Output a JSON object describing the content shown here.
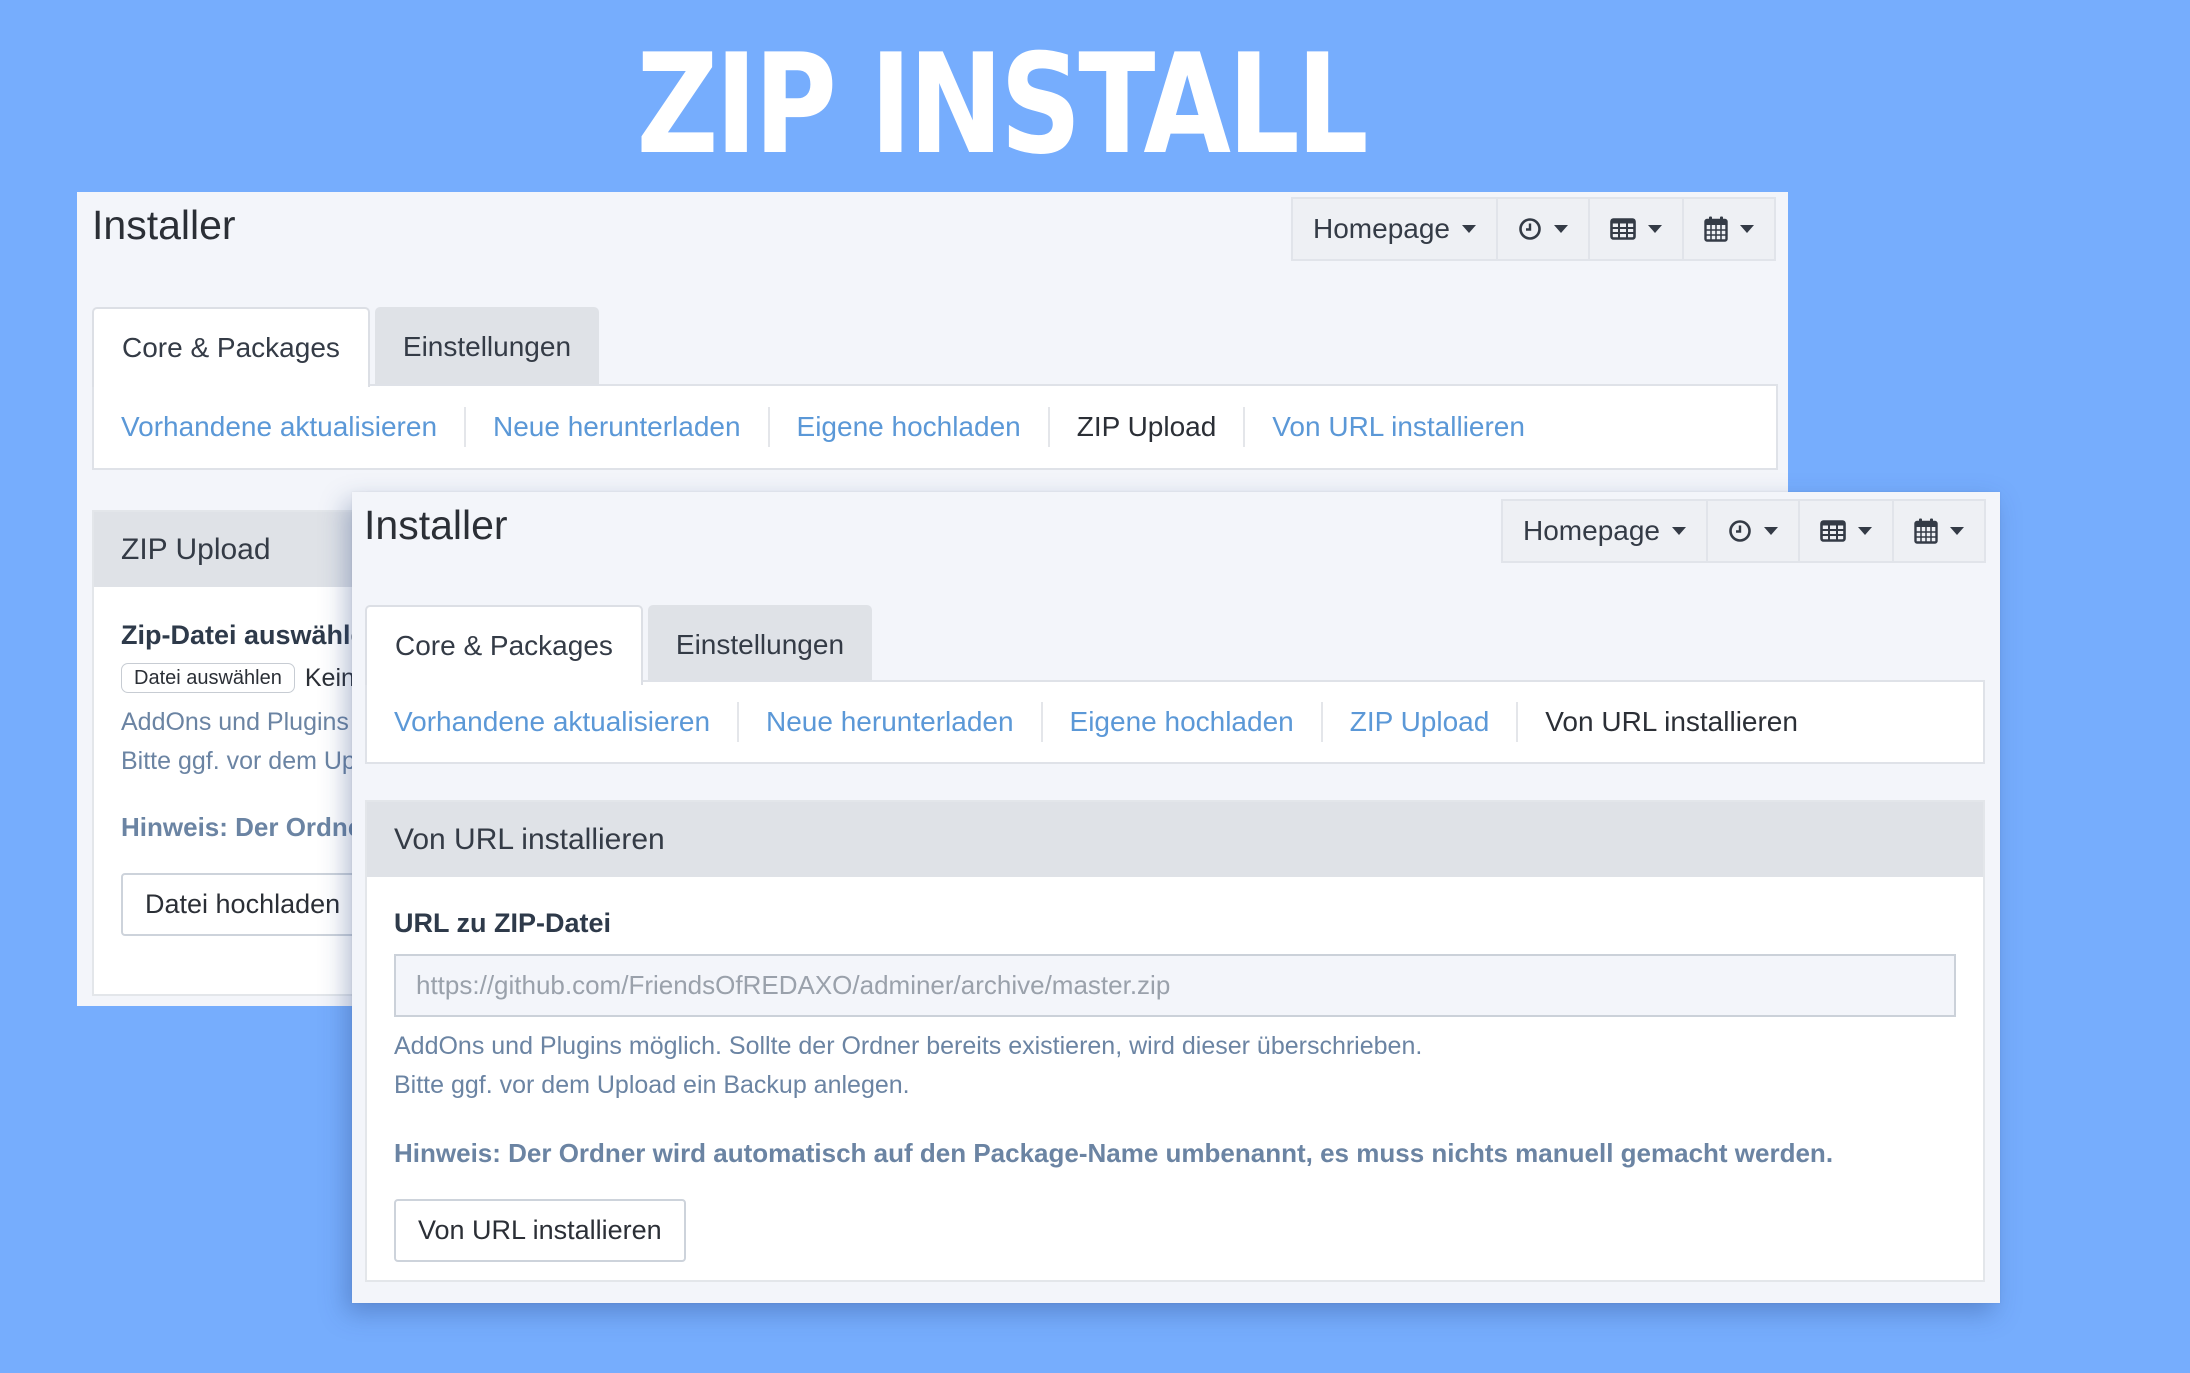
{
  "hero": {
    "title": "ZIP INSTALL"
  },
  "colors": {
    "background": "#76adfd",
    "link": "#5b98d7",
    "help_text": "#6b84a3",
    "panel_bg": "#f3f5fa"
  },
  "back_panel": {
    "page_title": "Installer",
    "toolbar": {
      "homepage_label": "Homepage",
      "icons": [
        "clock-icon",
        "table-icon",
        "calendar-icon"
      ]
    },
    "tabs": [
      {
        "label": "Core & Packages",
        "active": true
      },
      {
        "label": "Einstellungen",
        "active": false
      }
    ],
    "subnav": [
      {
        "label": "Vorhandene aktualisieren",
        "current": false
      },
      {
        "label": "Neue herunterladen",
        "current": false
      },
      {
        "label": "Eigene hochladen",
        "current": false
      },
      {
        "label": "ZIP Upload",
        "current": true
      },
      {
        "label": "Von URL installieren",
        "current": false
      }
    ],
    "section": {
      "title": "ZIP Upload",
      "field_label": "Zip-Datei auswählen",
      "file_button": "Datei auswählen",
      "file_status": "Keine Datei ausgewählt",
      "help_line1": "AddOns und Plugins möglich. Sollte der Ordner bereits existieren, wird dieser überschrieben.",
      "help_line2": "Bitte ggf. vor dem Upload ein Backup anlegen.",
      "hint": "Hinweis: Der Ordner wird automatisch auf den Package-Name umbenannt, es muss nichts manuell gemacht werden.",
      "submit_label": "Datei hochladen"
    }
  },
  "front_panel": {
    "page_title": "Installer",
    "toolbar": {
      "homepage_label": "Homepage",
      "icons": [
        "clock-icon",
        "table-icon",
        "calendar-icon"
      ]
    },
    "tabs": [
      {
        "label": "Core & Packages",
        "active": true
      },
      {
        "label": "Einstellungen",
        "active": false
      }
    ],
    "subnav": [
      {
        "label": "Vorhandene aktualisieren",
        "current": false
      },
      {
        "label": "Neue herunterladen",
        "current": false
      },
      {
        "label": "Eigene hochladen",
        "current": false
      },
      {
        "label": "ZIP Upload",
        "current": false
      },
      {
        "label": "Von URL installieren",
        "current": true
      }
    ],
    "section": {
      "title": "Von URL installieren",
      "field_label": "URL zu ZIP-Datei",
      "url_placeholder": "https://github.com/FriendsOfREDAXO/adminer/archive/master.zip",
      "help_line1": "AddOns und Plugins möglich. Sollte der Ordner bereits existieren, wird dieser überschrieben.",
      "help_line2": "Bitte ggf. vor dem Upload ein Backup anlegen.",
      "hint": "Hinweis: Der Ordner wird automatisch auf den Package-Name umbenannt, es muss nichts manuell gemacht werden.",
      "submit_label": "Von URL installieren"
    }
  }
}
